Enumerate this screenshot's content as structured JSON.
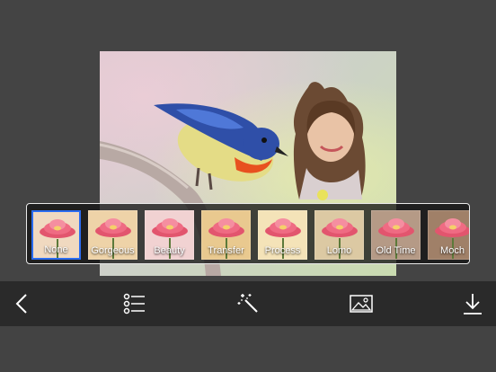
{
  "filters": [
    {
      "label": "None",
      "selected": true,
      "tint": "#f0d9c0"
    },
    {
      "label": "Gorgeous",
      "selected": false,
      "tint": "#eed3a8"
    },
    {
      "label": "Beauty",
      "selected": false,
      "tint": "#f1d2d2"
    },
    {
      "label": "Transfer",
      "selected": false,
      "tint": "#e9c98f"
    },
    {
      "label": "Process",
      "selected": false,
      "tint": "#f4e3b8"
    },
    {
      "label": "Lomo",
      "selected": false,
      "tint": "#dcc9a3"
    },
    {
      "label": "Old Time",
      "selected": false,
      "tint": "#b59a86"
    },
    {
      "label": "Moch",
      "selected": false,
      "tint": "#a08068"
    }
  ],
  "toolbar": {
    "back_icon": "chevron-left-icon",
    "list_icon": "list-icon",
    "magic_icon": "magic-wand-icon",
    "gallery_icon": "image-icon",
    "download_icon": "download-icon"
  },
  "colors": {
    "background": "#434343",
    "toolbar": "#2a2a2a",
    "selection": "#2b6cf0"
  }
}
